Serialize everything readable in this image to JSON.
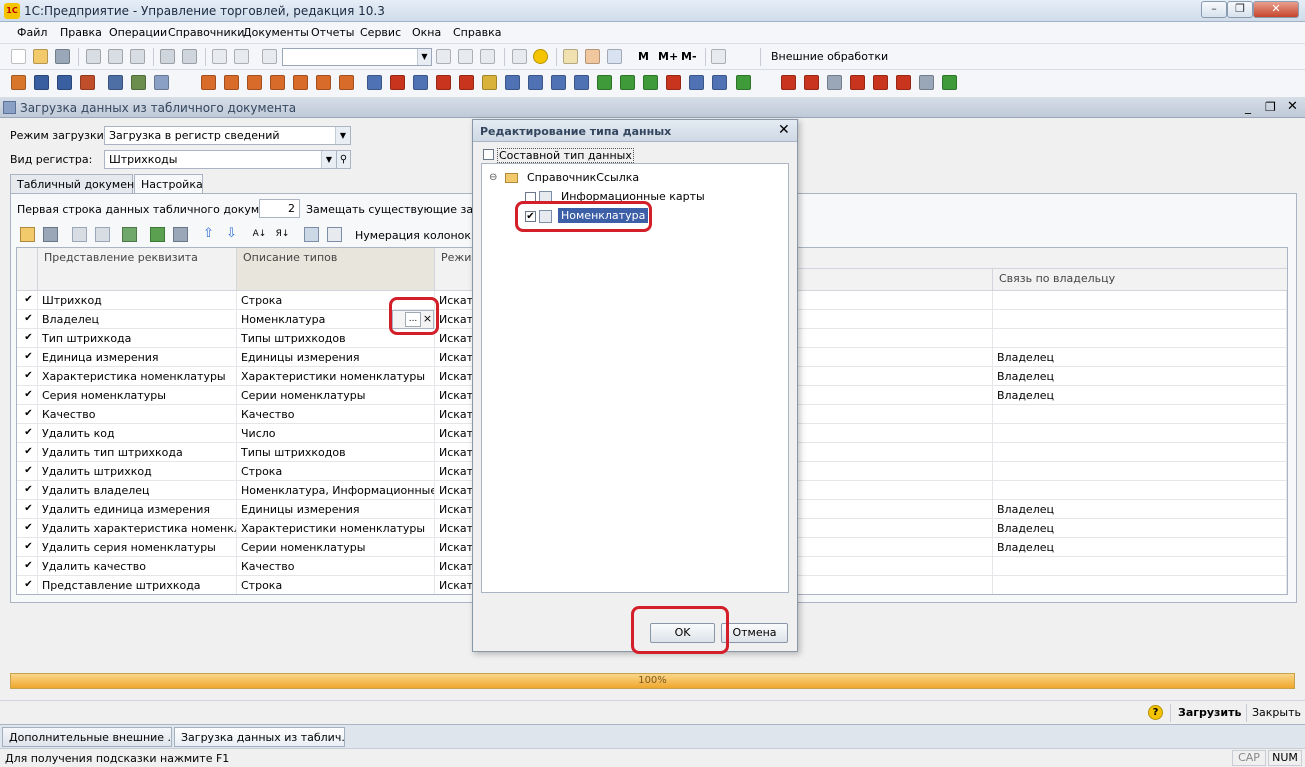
{
  "window": {
    "title": "1С:Предприятие - Управление торговлей, редакция 10.3",
    "app_icon": "1С"
  },
  "menu": [
    "Файл",
    "Правка",
    "Операции",
    "Справочники",
    "Документы",
    "Отчеты",
    "Сервис",
    "Окна",
    "Справка"
  ],
  "toolbar": {
    "external_processing": "Внешние обработки",
    "m": "M",
    "m_plus": "M+",
    "m_minus": "M-"
  },
  "doc_window": {
    "title": "Загрузка данных из табличного документа"
  },
  "form": {
    "mode_label": "Режим загрузки:",
    "mode_value": "Загрузка в регистр сведений",
    "register_label": "Вид регистра:",
    "register_value": "Штрихкоды",
    "tabs": [
      "Табличный документ",
      "Настройка"
    ],
    "first_row_label": "Первая строка данных табличного документа:",
    "first_row_value": "2",
    "replace_label": "Замещать существующие запис",
    "numbering_label": "Нумерация колонок"
  },
  "grid": {
    "headers": {
      "repr": "Представление реквизита",
      "types": "Описание типов",
      "mode": "Режим",
      "owner_link": "Связь по владельцу"
    },
    "rows": [
      {
        "checked": true,
        "repr": "Штрихкод",
        "types": "Строка",
        "mode": "Искат",
        "owner": ""
      },
      {
        "checked": true,
        "repr": "Владелец",
        "types": "Номенклатура",
        "mode": "Искат",
        "owner": ""
      },
      {
        "checked": true,
        "repr": "Тип штрихкода",
        "types": "Типы штрихкодов",
        "mode": "Искат",
        "owner": ""
      },
      {
        "checked": true,
        "repr": "Единица измерения",
        "types": "Единицы измерения",
        "mode": "Искат",
        "owner": "Владелец"
      },
      {
        "checked": true,
        "repr": "Характеристика номенклатуры",
        "types": "Характеристики номенклатуры",
        "mode": "Искат",
        "owner": "Владелец"
      },
      {
        "checked": true,
        "repr": "Серия номенклатуры",
        "types": "Серии номенклатуры",
        "mode": "Искат",
        "owner": "Владелец"
      },
      {
        "checked": true,
        "repr": "Качество",
        "types": "Качество",
        "mode": "Искат",
        "owner": ""
      },
      {
        "checked": true,
        "repr": "Удалить код",
        "types": "Число",
        "mode": "Искат",
        "owner": ""
      },
      {
        "checked": true,
        "repr": "Удалить тип штрихкода",
        "types": "Типы штрихкодов",
        "mode": "Искат",
        "owner": ""
      },
      {
        "checked": true,
        "repr": "Удалить штрихкод",
        "types": "Строка",
        "mode": "Искат",
        "owner": ""
      },
      {
        "checked": true,
        "repr": "Удалить владелец",
        "types": "Номенклатура, Информационные к...",
        "mode": "Искат",
        "owner": ""
      },
      {
        "checked": true,
        "repr": "Удалить единица измерения",
        "types": "Единицы измерения",
        "mode": "Искат",
        "owner": "Владелец"
      },
      {
        "checked": true,
        "repr": "Удалить характеристика номенкла...",
        "types": "Характеристики номенклатуры",
        "mode": "Искат",
        "owner": "Владелец"
      },
      {
        "checked": true,
        "repr": "Удалить серия номенклатуры",
        "types": "Серии номенклатуры",
        "mode": "Искат",
        "owner": "Владелец"
      },
      {
        "checked": true,
        "repr": "Удалить качество",
        "types": "Качество",
        "mode": "Искат",
        "owner": ""
      },
      {
        "checked": true,
        "repr": "Представление штрихкода",
        "types": "Строка",
        "mode": "Искат",
        "owner": ""
      }
    ],
    "edit_ellipsis": "...",
    "edit_clear": "×"
  },
  "progress": {
    "value": 100,
    "label": "100%"
  },
  "actions": {
    "load": "Загрузить",
    "close": "Закрыть",
    "help": "?"
  },
  "taskbar": [
    "Дополнительные внешние ...",
    "Загрузка данных из таблич..."
  ],
  "status": {
    "hint": "Для получения подсказки нажмите F1",
    "cap": "CAP",
    "num": "NUM"
  },
  "dialog": {
    "title": "Редактирование типа данных",
    "composite_label": "Составной тип данных",
    "composite_checked": false,
    "tree_root": "СправочникСсылка",
    "items": [
      {
        "label": "Информационные карты",
        "checked": false
      },
      {
        "label": "Номенклатура",
        "checked": true
      }
    ],
    "ok": "OK",
    "cancel": "Отмена"
  },
  "colors": {
    "accent_red": "#d21f2a",
    "progress": "#f0a72d",
    "selection": "#3d5fa8"
  }
}
